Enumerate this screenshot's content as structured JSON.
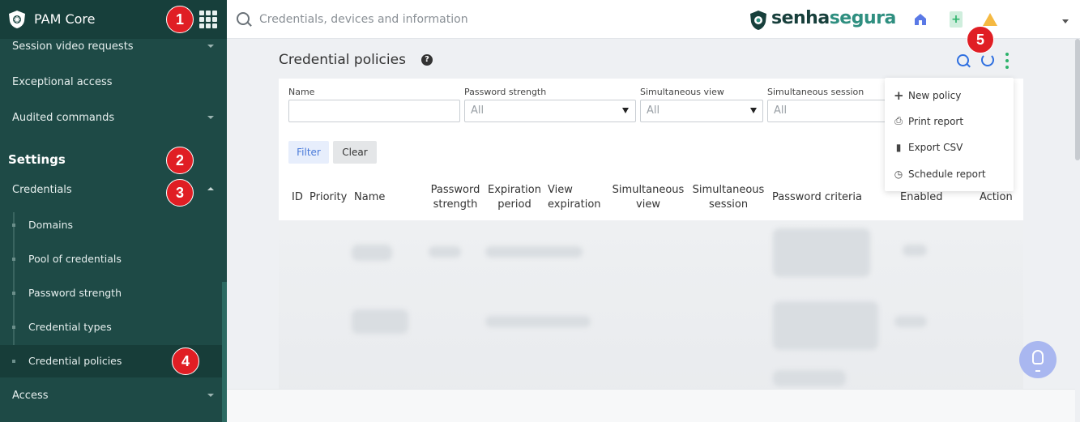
{
  "sidebar": {
    "app_title": "PAM Core",
    "items_top": [
      {
        "label": "Session video requests",
        "has_caret": true
      },
      {
        "label": "Exceptional access",
        "has_caret": false
      },
      {
        "label": "Audited commands",
        "has_caret": true
      }
    ],
    "section_title": "Settings",
    "credentials_label": "Credentials",
    "sub_items": [
      "Domains",
      "Pool of credentials",
      "Password strength",
      "Credential types",
      "Credential policies"
    ],
    "active_sub_item": "Credential policies",
    "access_label": "Access"
  },
  "topbar": {
    "search_placeholder": "Credentials, devices and information",
    "logo_part1": "senha",
    "logo_part2": "segura"
  },
  "page": {
    "title": "Credential policies"
  },
  "filters": {
    "name_label": "Name",
    "name_value": "",
    "password_strength_label": "Password strength",
    "password_strength_value": "All",
    "simultaneous_view_label": "Simultaneous view",
    "simultaneous_view_value": "All",
    "simultaneous_session_label": "Simultaneous session",
    "simultaneous_session_value": "All",
    "filter_button": "Filter",
    "clear_button": "Clear"
  },
  "table": {
    "columns": [
      "ID",
      "Priority",
      "Name",
      "Password\nstrength",
      "Expiration\nperiod",
      "View\nexpiration",
      "Simultaneous\nview",
      "Simultaneous\nsession",
      "Password criteria",
      "Enabled",
      "Action"
    ]
  },
  "menu": {
    "items": [
      {
        "label": "New policy",
        "icon": "plus-icon"
      },
      {
        "label": "Print report",
        "icon": "printer-icon"
      },
      {
        "label": "Export CSV",
        "icon": "file-icon"
      },
      {
        "label": "Schedule report",
        "icon": "clock-icon"
      }
    ]
  },
  "callouts": [
    "1",
    "2",
    "3",
    "4",
    "5"
  ],
  "colors": {
    "sidebar": "#1e4a46",
    "accent_green": "#2cb36b",
    "accent_blue": "#2e6fe0",
    "callout_red": "#e01e24"
  }
}
